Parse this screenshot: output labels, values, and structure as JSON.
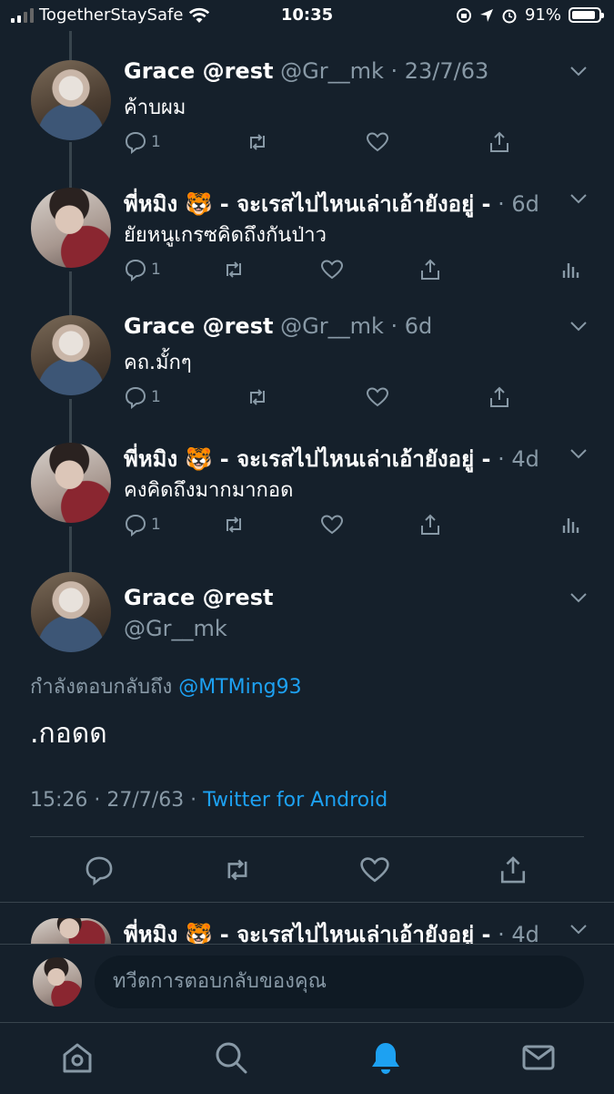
{
  "status_bar": {
    "carrier": "TogetherStaySafe",
    "time": "10:35",
    "battery_percent": "91%",
    "battery_level": 0.91,
    "icons": [
      "signal-icon",
      "wifi-icon",
      "rotation-lock-icon",
      "location-icon",
      "alarm-icon",
      "battery-icon"
    ]
  },
  "thread": [
    {
      "name": "Grace @rest",
      "handle": "@Gr__mk",
      "time": "23/7/63",
      "text": "ค้าบผม",
      "reply_count": "1",
      "avatar": "grace",
      "has_analytics": false
    },
    {
      "name": "พี่หมิง 🐯 - จะเรสไปไหนเล่าเอ้ายังอยู่ -",
      "handle": "",
      "time": "6d",
      "text": "ยัยหนูเกรซคิดถึงกันป่าว",
      "reply_count": "1",
      "avatar": "ming",
      "has_analytics": true
    },
    {
      "name": "Grace @rest",
      "handle": "@Gr__mk",
      "time": "6d",
      "text": "คถ.มั้กๆ",
      "reply_count": "1",
      "avatar": "grace",
      "has_analytics": false
    },
    {
      "name": "พี่หมิง 🐯 - จะเรสไปไหนเล่าเอ้ายังอยู่ -",
      "handle": "",
      "time": "4d",
      "text": "คงคิดถึงมากมากอด",
      "reply_count": "1",
      "avatar": "ming",
      "has_analytics": true
    }
  ],
  "focus_tweet": {
    "name": "Grace @rest",
    "handle": "@Gr__mk",
    "replying_to_label": "กำลังตอบกลับถึง",
    "replying_to_mention": "@MTMing93",
    "text": ".กอดด",
    "timestamp": "15:26 · 27/7/63 ·",
    "client": "Twitter for Android"
  },
  "next_tweet": {
    "name": "พี่หมิง 🐯 - จะเรสไปไหนเล่าเอ้ายังอยู่ -",
    "time": "4d"
  },
  "reply_box": {
    "placeholder": "ทวีตการตอบกลับของคุณ"
  },
  "tab_bar": {
    "tabs": [
      "home",
      "search",
      "notifications",
      "messages"
    ],
    "active": "notifications"
  },
  "colors": {
    "background": "#15202b",
    "secondary_text": "#8899a6",
    "accent": "#1da1f2",
    "divider": "#38444d"
  }
}
